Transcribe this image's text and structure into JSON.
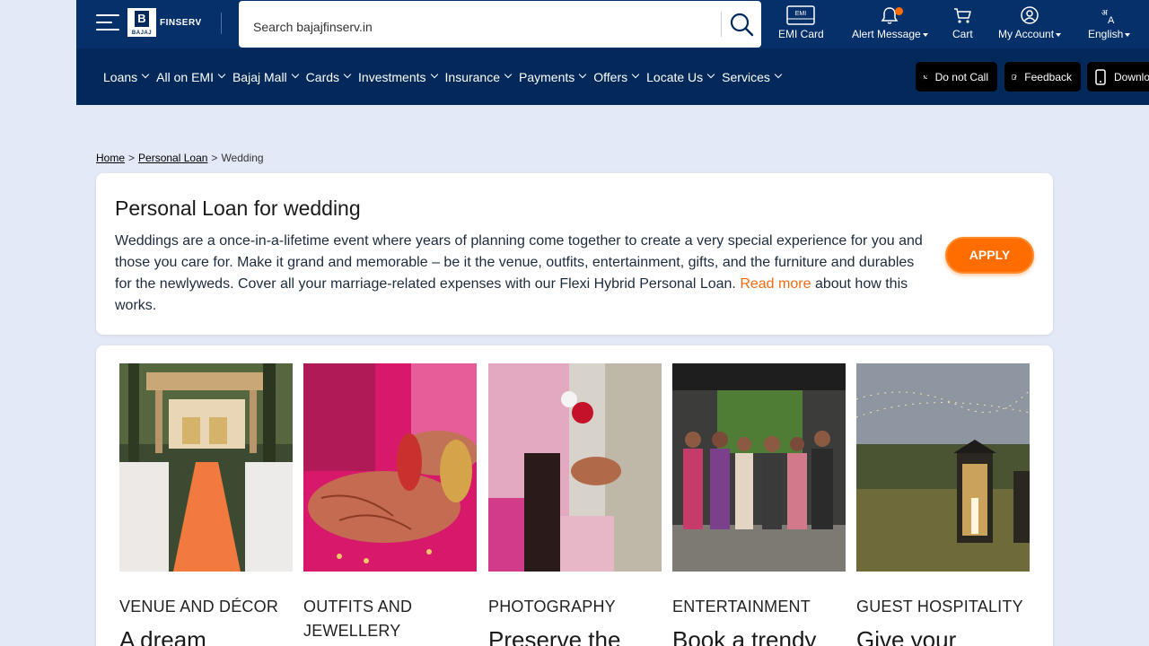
{
  "header": {
    "logo_text": "FINSERV",
    "logo_brand": "BAJAJ",
    "search_placeholder": "Search bajajfinserv.in",
    "top_items": [
      {
        "label": "EMI Card"
      },
      {
        "label": "Alert Message"
      },
      {
        "label": "Cart"
      },
      {
        "label": "My Account"
      },
      {
        "label": "English"
      }
    ],
    "emi_badge": "EMI",
    "alert_dot_color": "#ff6d00"
  },
  "nav": {
    "items": [
      "Loans",
      "All on EMI",
      "Bajaj Mall",
      "Cards",
      "Investments",
      "Insurance",
      "Payments",
      "Offers",
      "Locate Us",
      "Services"
    ],
    "utility": [
      "Do not Call",
      "Feedback",
      "Downlo"
    ]
  },
  "breadcrumb": {
    "home": "Home",
    "sep": ">",
    "personal_loan": "Personal Loan",
    "current": "Wedding"
  },
  "intro": {
    "title": "Personal Loan for wedding",
    "body": "Weddings are a once-in-a-lifetime event where years of planning come together to create a very special experience for you and those you care for. Make it grand and memorable – be it the venue, outfits, entertainment, gifts, and the furniture and durables for the newlyweds. Cover all your marriage-related expenses with our Flexi Hybrid Personal Loan.",
    "read_more": "Read more",
    "body_tail": "about how this works.",
    "apply_label": "APPLY"
  },
  "categories": [
    {
      "tag": "VENUE AND DÉCOR",
      "title": "A dream"
    },
    {
      "tag": "OUTFITS AND JEWELLERY",
      "title": ""
    },
    {
      "tag": "PHOTOGRAPHY",
      "title": "Preserve the"
    },
    {
      "tag": "ENTERTAINMENT",
      "title": "Book a trendy"
    },
    {
      "tag": "GUEST HOSPITALITY",
      "title": "Give your"
    }
  ],
  "colors": {
    "header_bg": "#02295a",
    "accent": "#ff6d00",
    "page_bg": "#e3e9f6"
  }
}
